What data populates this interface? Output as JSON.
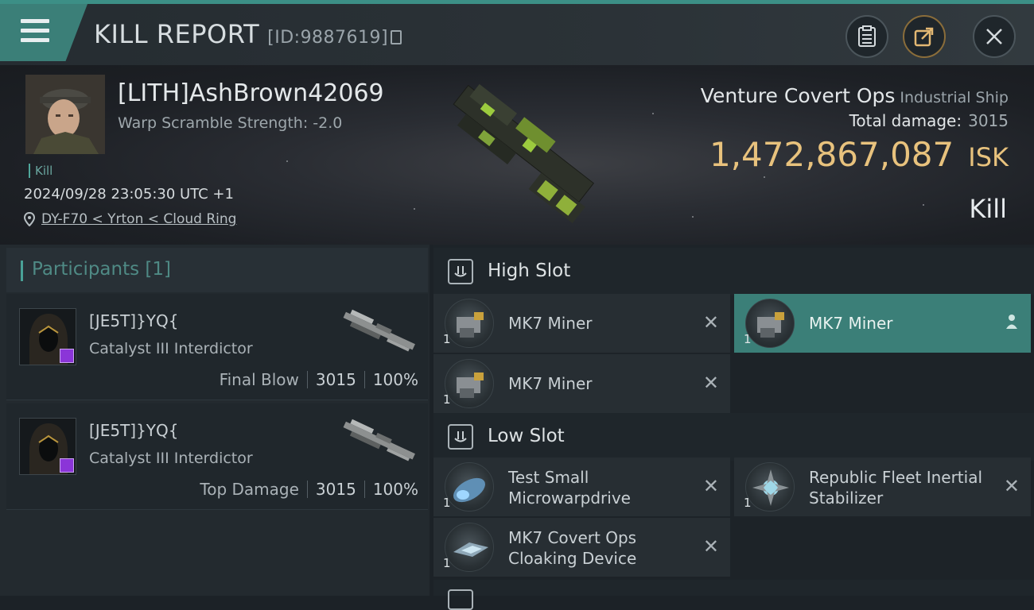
{
  "header": {
    "title": "KILL REPORT",
    "report_id": "[ID:9887619]"
  },
  "victim": {
    "name": "[LITH]AshBrown42069",
    "warp_scramble": "Warp Scramble Strength: -2.0",
    "tag": "Kill",
    "datetime": "2024/09/28 23:05:30 UTC +1",
    "location": "DY-F70 < Yrton < Cloud Ring",
    "ship_name": "Venture Covert Ops",
    "ship_class": "Industrial Ship",
    "total_damage_label": "Total damage:",
    "total_damage": "3015",
    "isk_value": "1,472,867,087",
    "isk_unit": "ISK",
    "result": "Kill"
  },
  "participants": {
    "label": "Participants",
    "count": "[1]",
    "items": [
      {
        "name": "[JE5T]}YQ{",
        "ship": "Catalyst III Interdictor",
        "stat_label": "Final Blow",
        "damage": "3015",
        "percent": "100%"
      },
      {
        "name": "[JE5T]}YQ{",
        "ship": "Catalyst III Interdictor",
        "stat_label": "Top Damage",
        "damage": "3015",
        "percent": "100%"
      }
    ]
  },
  "fitting": {
    "high_slot_label": "High Slot",
    "low_slot_label": "Low Slot",
    "high_slot": [
      {
        "name": "MK7 Miner",
        "qty": "1"
      },
      {
        "name": "MK7 Miner",
        "qty": "1"
      },
      {
        "name": "MK7 Miner",
        "qty": "1"
      }
    ],
    "low_slot": [
      {
        "name_l1": "Test Small",
        "name_l2": "Microwarpdrive",
        "qty": "1"
      },
      {
        "name_l1": "Republic Fleet Inertial",
        "name_l2": "Stabilizer",
        "qty": "1"
      },
      {
        "name_l1": "MK7 Covert Ops",
        "name_l2": "Cloaking Device",
        "qty": "1"
      }
    ],
    "remove_glyph": "✕"
  },
  "colors": {
    "accent": "#3b7f78",
    "isk": "#e8c27d",
    "badge": "#8b35d8"
  }
}
